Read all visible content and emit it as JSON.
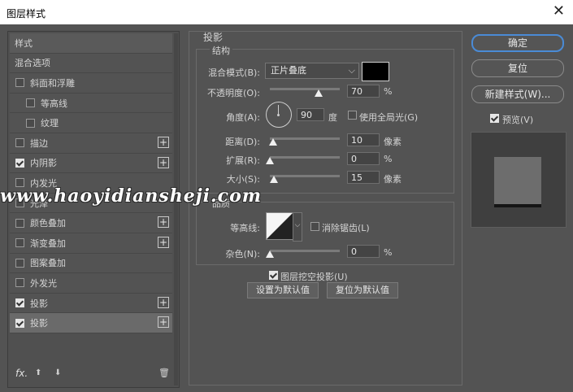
{
  "window": {
    "title": "图层样式"
  },
  "left_panel": {
    "items": [
      {
        "label": "样式",
        "kind": "header"
      },
      {
        "label": "混合选项",
        "kind": "plain"
      },
      {
        "label": "斜面和浮雕",
        "kind": "check",
        "checked": false
      },
      {
        "label": "等高线",
        "kind": "subcheck",
        "checked": false
      },
      {
        "label": "纹理",
        "kind": "subcheck",
        "checked": false
      },
      {
        "label": "描边",
        "kind": "check",
        "checked": false,
        "plus": true
      },
      {
        "label": "内阴影",
        "kind": "check",
        "checked": true,
        "plus": true
      },
      {
        "label": "内发光",
        "kind": "check",
        "checked": false
      },
      {
        "label": "光泽",
        "kind": "check",
        "checked": false
      },
      {
        "label": "颜色叠加",
        "kind": "check",
        "checked": false,
        "plus": true
      },
      {
        "label": "渐变叠加",
        "kind": "check",
        "checked": false,
        "plus": true
      },
      {
        "label": "图案叠加",
        "kind": "check",
        "checked": false
      },
      {
        "label": "外发光",
        "kind": "check",
        "checked": false
      },
      {
        "label": "投影",
        "kind": "check",
        "checked": true,
        "plus": true
      },
      {
        "label": "投影",
        "kind": "check",
        "checked": true,
        "plus": true,
        "selected": true
      }
    ],
    "plus_symbol": "+",
    "fx_label": "fx.",
    "up_arrow": "⬆",
    "down_arrow": "⬇",
    "trash_icon": "🗑"
  },
  "section": {
    "title": "投影",
    "structure": "结构",
    "quality": "品质"
  },
  "structure": {
    "blend_mode_label": "混合模式(B):",
    "blend_mode_value": "正片叠底",
    "blend_color": "#000000",
    "opacity_label": "不透明度(O):",
    "opacity_value": "70",
    "opacity_fraction": 0.7,
    "percent": "%",
    "angle_label": "角度(A):",
    "angle_value": "90",
    "degree_unit": "度",
    "global_light_label": "使用全局光(G)",
    "global_light_checked": false,
    "distance_label": "距离(D):",
    "distance_value": "10",
    "distance_fraction": 0.05,
    "pixel_unit": "像素",
    "spread_label": "扩展(R):",
    "spread_value": "0",
    "spread_fraction": 0.0,
    "size_label": "大小(S):",
    "size_value": "15",
    "size_fraction": 0.06
  },
  "quality": {
    "contour_label": "等高线:",
    "antialias_label": "消除锯齿(L)",
    "antialias_checked": false,
    "noise_label": "杂色(N):",
    "noise_value": "0",
    "noise_fraction": 0.0
  },
  "bottom_options": {
    "knockout_label": "图层挖空投影(U)",
    "knockout_checked": true,
    "set_default": "设置为默认值",
    "reset_default": "复位为默认值"
  },
  "right_panel": {
    "ok": "确定",
    "reset": "复位",
    "new_style": "新建样式(W)...",
    "preview_label": "预览(V)",
    "preview_checked": true
  },
  "watermark": "www.haoyidiansheji.com"
}
